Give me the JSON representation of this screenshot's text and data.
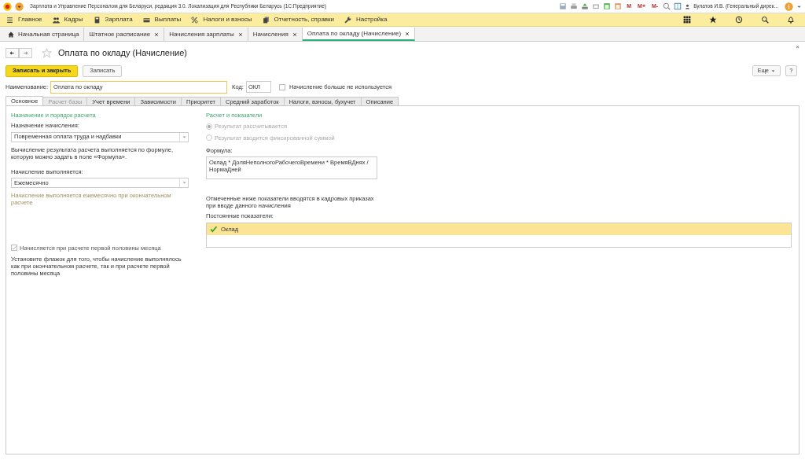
{
  "window": {
    "title": "Зарплата и Управление Персоналом для Беларуси, редакция 3.0. Локализация для Республики Беларусь  (1С:Предприятие)"
  },
  "top_toolbar": {
    "memory_buttons": [
      "M",
      "M+",
      "M-"
    ],
    "user": "Булатов И.В. (Генеральный дирек..."
  },
  "menu": [
    {
      "label": "Главное"
    },
    {
      "label": "Кадры"
    },
    {
      "label": "Зарплата"
    },
    {
      "label": "Выплаты"
    },
    {
      "label": "Налоги и взносы"
    },
    {
      "label": "Отчетность, справки"
    },
    {
      "label": "Настройка"
    }
  ],
  "open_tabs": [
    {
      "label": "Начальная страница",
      "selected": false,
      "closable": false
    },
    {
      "label": "Штатное расписание",
      "selected": false,
      "closable": true
    },
    {
      "label": "Начисления зарплаты",
      "selected": false,
      "closable": true
    },
    {
      "label": "Начисления",
      "selected": false,
      "closable": true
    },
    {
      "label": "Оплата по окладу (Начисление)",
      "selected": true,
      "closable": true
    }
  ],
  "form": {
    "title": "Оплата по окладу (Начисление)",
    "close": "×",
    "buttons": {
      "save_close": "Записать и закрыть",
      "save": "Записать",
      "more": "Еще",
      "help": "?"
    },
    "name_label": "Наименование:",
    "name_value": "Оплата по окладу",
    "code_label": "Код:",
    "code_value": "ОКЛ",
    "unused": {
      "label": "Начисление больше не используется",
      "checked": false
    },
    "tabs": [
      {
        "label": "Основное",
        "selected": true,
        "disabled": false
      },
      {
        "label": "Расчет базы",
        "selected": false,
        "disabled": true
      },
      {
        "label": "Учет времени",
        "selected": false,
        "disabled": false
      },
      {
        "label": "Зависимости",
        "selected": false,
        "disabled": false
      },
      {
        "label": "Приоритет",
        "selected": false,
        "disabled": false
      },
      {
        "label": "Средний заработок",
        "selected": false,
        "disabled": false
      },
      {
        "label": "Налоги, взносы, бухучет",
        "selected": false,
        "disabled": false
      },
      {
        "label": "Описание",
        "selected": false,
        "disabled": false
      }
    ],
    "left": {
      "heading": "Назначение и порядок расчета",
      "purpose_label": "Назначение начисления:",
      "purpose_value": "Повременная оплата труда и надбавки",
      "purpose_note": "Вычисление результата расчета выполняется по формуле, которую можно задать в поле «Формула».",
      "period_label": "Начисление выполняется:",
      "period_value": "Ежемесячно",
      "period_note": "Начисление выполняется ежемесячно при окончательном расчете",
      "first_half": {
        "label": "Начисляется при расчете первой половины месяца",
        "checked": true,
        "disabled": true
      },
      "first_half_note": "Установите флажок для того, чтобы начисление выполнялось как при окончательном расчете, так и при расчете первой половины месяца"
    },
    "right": {
      "heading": "Расчет и показатели",
      "result_options": [
        {
          "label": "Результат рассчитывается",
          "selected": true,
          "disabled": true
        },
        {
          "label": "Результат вводится фиксированной суммой",
          "selected": false,
          "disabled": true
        }
      ],
      "formula_label": "Формула:",
      "formula_value": "Оклад * ДоляНеполногоРабочегоВремени * ВремяВДнях / НормаДней",
      "indicators_note": "Отмеченные ниже показатели вводятся в кадровых приказах при вводе данного начисления",
      "indicators_label": "Постоянные показатели:",
      "indicators": [
        {
          "label": "Оклад",
          "checked": true,
          "selected": true
        }
      ]
    }
  }
}
